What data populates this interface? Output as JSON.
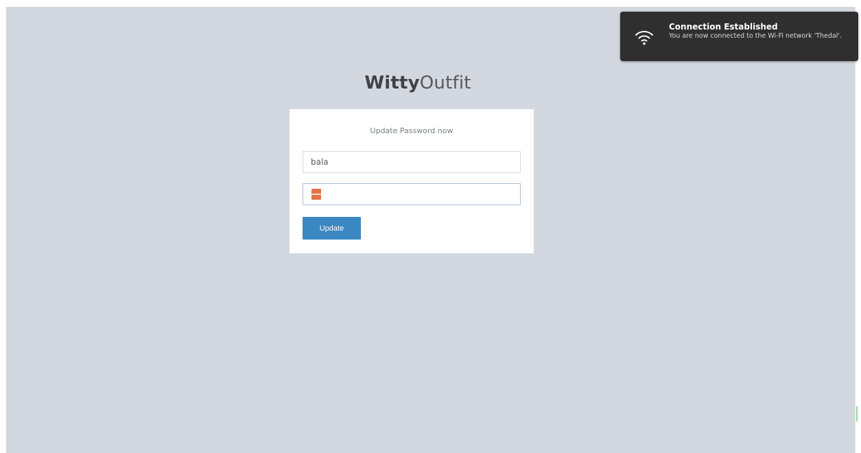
{
  "logo": {
    "bold": "Witty",
    "light": "Outfit"
  },
  "form": {
    "title": "Update Password now",
    "username_value": "bala",
    "password_value": "",
    "button_label": "Update"
  },
  "notification": {
    "icon": "wifi-icon",
    "title": "Connection Established",
    "message": "You are now connected to the Wi-Fi network 'Thedal'."
  },
  "colors": {
    "background": "#d3d7df",
    "button": "#3a87c2",
    "toast": "#2f2f2f",
    "key_icon": "#e0734a"
  }
}
